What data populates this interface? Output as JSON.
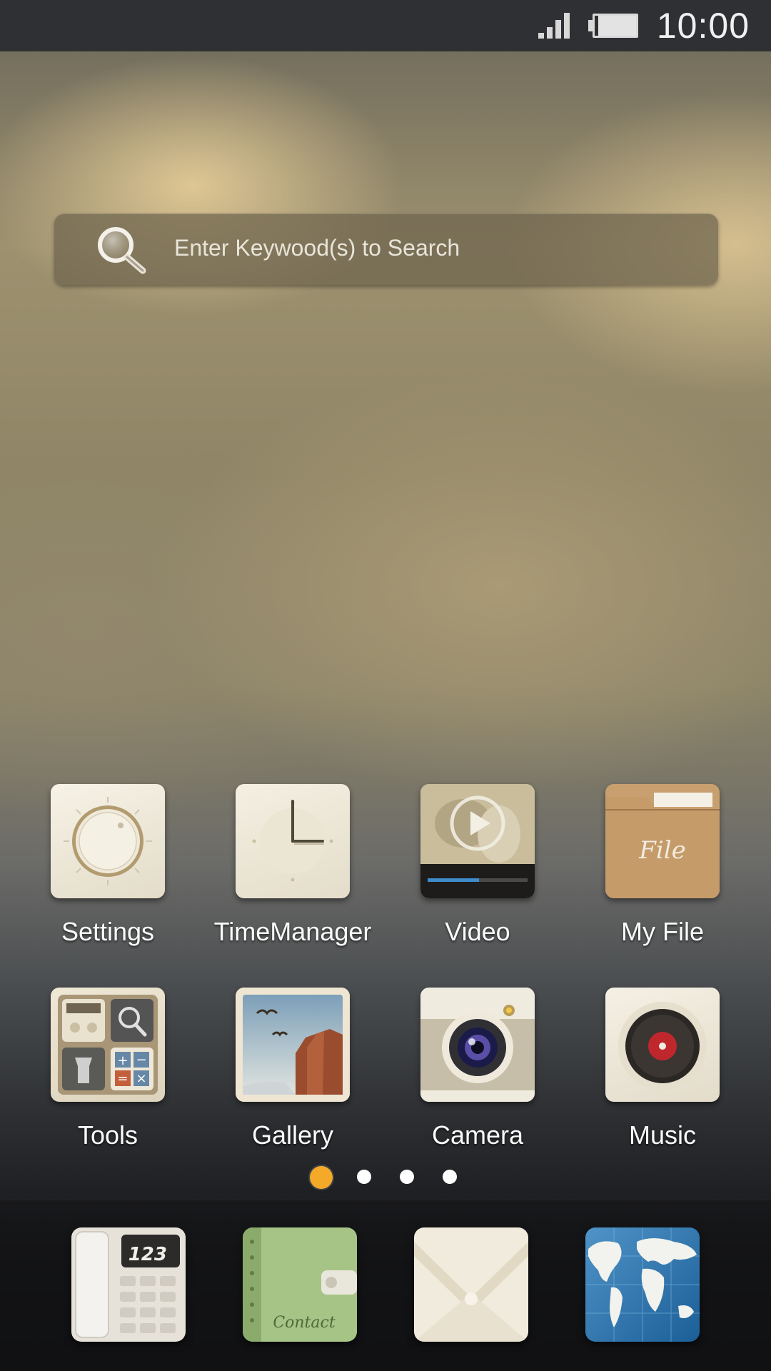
{
  "status_bar": {
    "time": "10:00",
    "icons": [
      "signal-icon",
      "battery-icon"
    ]
  },
  "search": {
    "placeholder": "Enter Keywood(s) to Search",
    "icon": "search-icon"
  },
  "apps": [
    {
      "label": "Settings",
      "icon": "settings-icon"
    },
    {
      "label": "TimeManager",
      "icon": "clock-icon"
    },
    {
      "label": "Video",
      "icon": "video-icon"
    },
    {
      "label": "My File",
      "icon": "folder-icon",
      "icon_text": "File"
    },
    {
      "label": "Tools",
      "icon": "tools-icon"
    },
    {
      "label": "Gallery",
      "icon": "gallery-icon"
    },
    {
      "label": "Camera",
      "icon": "camera-icon"
    },
    {
      "label": "Music",
      "icon": "music-icon"
    }
  ],
  "pager": {
    "pages": 4,
    "current": 1
  },
  "dock": [
    {
      "name": "Phone",
      "icon": "phone-icon",
      "icon_text": "123"
    },
    {
      "name": "Contacts",
      "icon": "contacts-icon",
      "icon_text": "Contact"
    },
    {
      "name": "Messages",
      "icon": "envelope-icon"
    },
    {
      "name": "Browser",
      "icon": "globe-icon"
    }
  ],
  "colors": {
    "accent_dot": "#f5a928",
    "status_bar": "#2e3033"
  }
}
